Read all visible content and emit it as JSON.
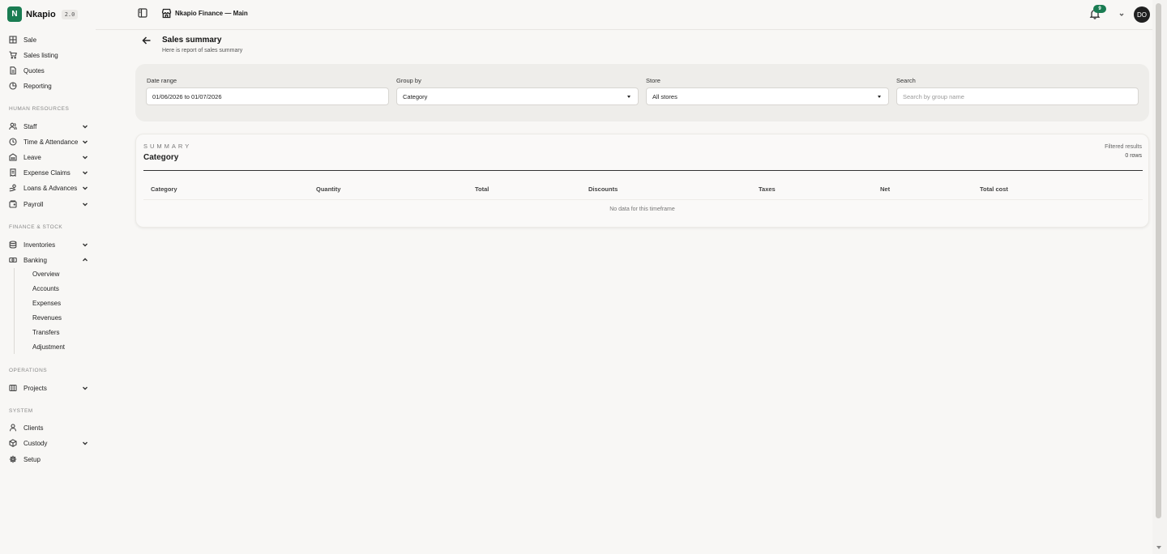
{
  "brand": {
    "logo_letter": "N",
    "name": "Nkapio",
    "version": "2.0"
  },
  "topbar": {
    "store_name": "Nkapio Finance — Main",
    "notification_count": "9",
    "avatar_initials": "DO"
  },
  "sidebar": {
    "top_items": [
      "Sale",
      "Sales listing",
      "Quotes",
      "Reporting"
    ],
    "sections": {
      "human_resources": {
        "title": "HUMAN RESOURCES",
        "items": [
          "Staff",
          "Time & Attendance",
          "Leave",
          "Expense Claims",
          "Loans & Advances",
          "Payroll"
        ]
      },
      "finance_stock": {
        "title": "FINANCE & STOCK",
        "items": [
          "Inventories",
          "Banking"
        ],
        "banking_subitems": [
          "Overview",
          "Accounts",
          "Expenses",
          "Revenues",
          "Transfers",
          "Adjustment"
        ]
      },
      "operations": {
        "title": "OPERATIONS",
        "items": [
          "Projects"
        ]
      },
      "system": {
        "title": "SYSTEM",
        "items": [
          "Clients",
          "Custody",
          "Setup"
        ]
      }
    }
  },
  "page": {
    "title": "Sales summary",
    "subtitle": "Here is report of sales summary"
  },
  "filters": {
    "date_range": {
      "label": "Date range",
      "value": "01/06/2026 to 01/07/2026"
    },
    "group_by": {
      "label": "Group by",
      "value": "Category"
    },
    "store": {
      "label": "Store",
      "value": "All stores"
    },
    "search": {
      "label": "Search",
      "placeholder": "Search by group name"
    }
  },
  "summary": {
    "kicker": "SUMMARY",
    "title": "Category",
    "filtered_label": "Filtered results",
    "rows_label": "0 rows",
    "columns": [
      "Category",
      "Quantity",
      "Total",
      "Discounts",
      "Taxes",
      "Net",
      "Total cost"
    ],
    "empty_message": "No data for this timeframe"
  }
}
